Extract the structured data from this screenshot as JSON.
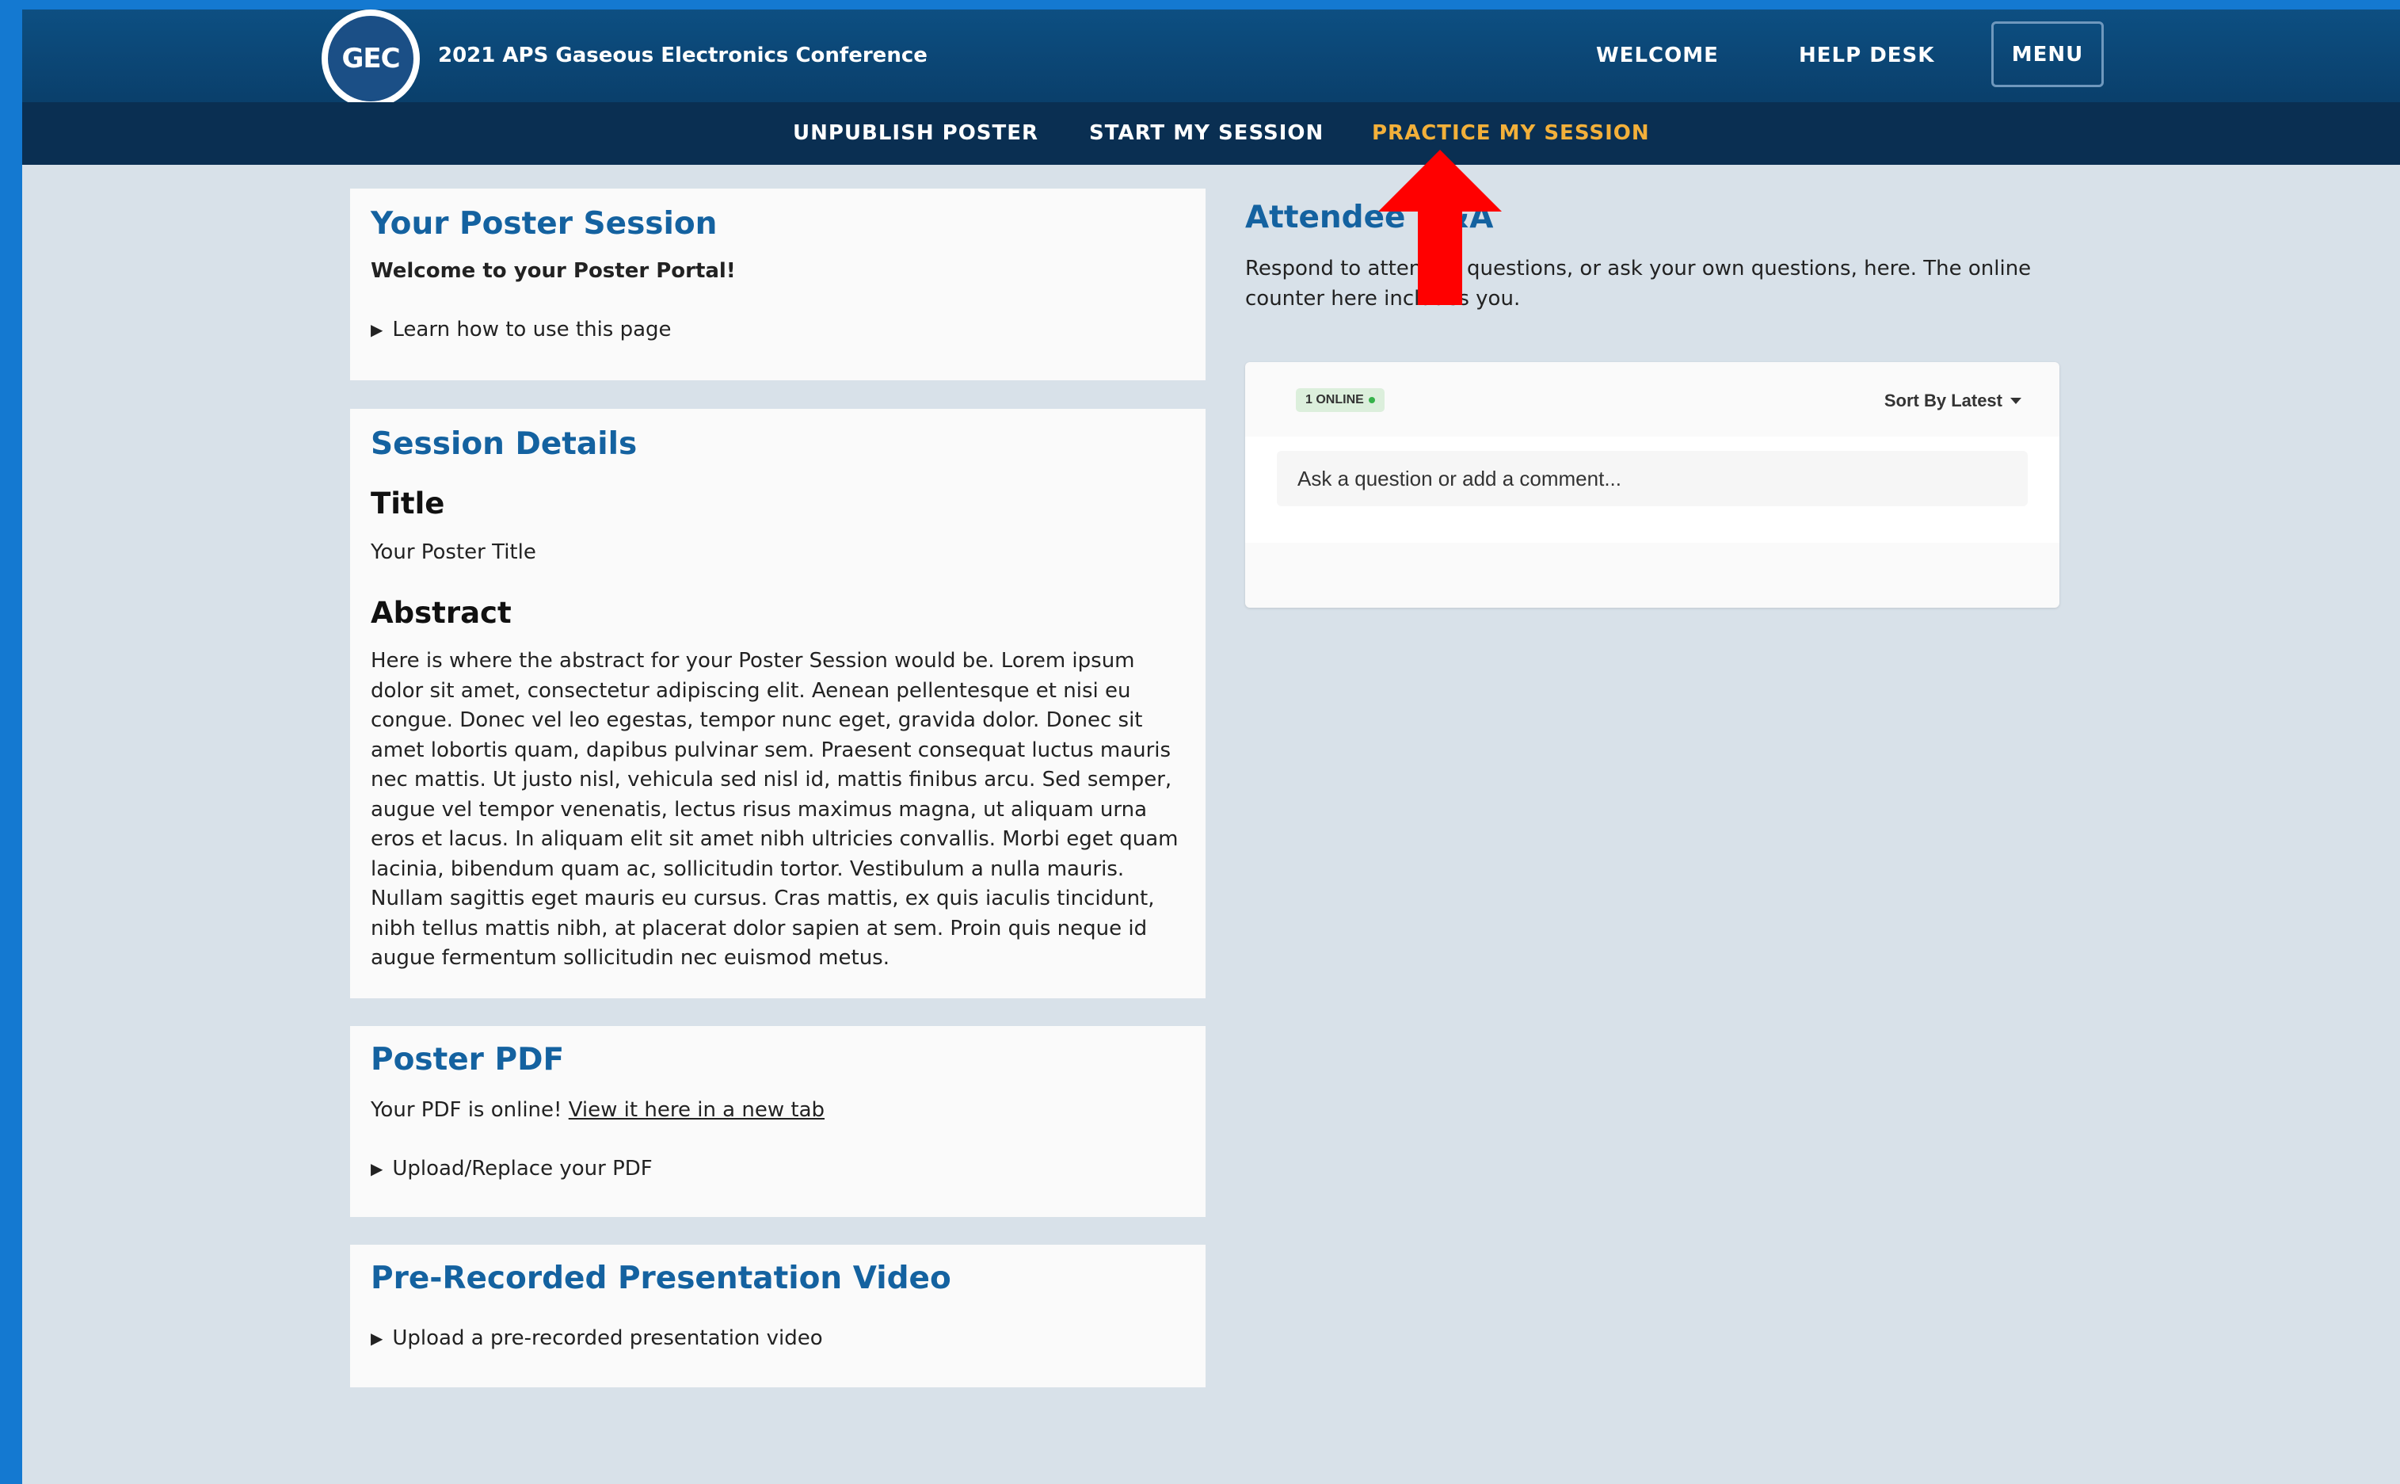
{
  "header": {
    "logo_text": "GEC",
    "site_title": "2021 APS Gaseous Electronics Conference",
    "nav": {
      "welcome": "WELCOME",
      "help_desk": "HELP DESK",
      "menu": "MENU"
    }
  },
  "subnav": {
    "unpublish": "UNPUBLISH POSTER",
    "start": "START MY SESSION",
    "practice": "PRACTICE MY SESSION",
    "active_color": "#f3b03a"
  },
  "poster_session": {
    "heading": "Your Poster Session",
    "welcome": "Welcome to your Poster Portal!",
    "learn": "Learn how to use this page"
  },
  "session_details": {
    "heading": "Session Details",
    "title_label": "Title",
    "title_value": "Your Poster Title",
    "abstract_label": "Abstract",
    "abstract_text": "Here is where the abstract for your Poster Session would be. Lorem ipsum dolor sit amet, consectetur adipiscing elit. Aenean pellentesque et nisi eu congue. Donec vel leo egestas, tempor nunc eget, gravida dolor. Donec sit amet lobortis quam, dapibus pulvinar sem. Praesent consequat luctus mauris nec mattis. Ut justo nisl, vehicula sed nisl id, mattis finibus arcu. Sed semper, augue vel tempor venenatis, lectus risus maximus magna, ut aliquam urna eros et lacus. In aliquam elit sit amet nibh ultricies convallis. Morbi eget quam lacinia, bibendum quam ac, sollicitudin tortor. Vestibulum a nulla mauris. Nullam sagittis eget mauris eu cursus. Cras mattis, ex quis iaculis tincidunt, nibh tellus mattis nibh, at placerat dolor sapien at sem. Proin quis neque id augue fermentum sollicitudin nec euismod metus."
  },
  "poster_pdf": {
    "heading": "Poster PDF",
    "status": "Your PDF is online!",
    "link": "View it here in a new tab",
    "upload": "Upload/Replace your PDF"
  },
  "video": {
    "heading": "Pre-Recorded Presentation Video",
    "upload": "Upload a pre-recorded presentation video"
  },
  "attendee_qa": {
    "heading": "Attendee Q&A",
    "description": "Respond to attendee questions, or ask your own questions, here. The online counter here includes you.",
    "online_badge": "1 ONLINE",
    "sort_label": "Sort By Latest",
    "input_placeholder": "Ask a question or add a comment..."
  },
  "icons": {
    "logo": "gec-logo-icon",
    "disclosure": "triangle-right-icon",
    "sort": "caret-down-icon",
    "annotation": "red-arrow-up-icon"
  },
  "colors": {
    "brand_blue": "#1462a0",
    "header_bg": "#0d4f82",
    "subnav_bg": "#0a2f52",
    "arrow": "#ff0000",
    "online_green": "#36b24a"
  }
}
